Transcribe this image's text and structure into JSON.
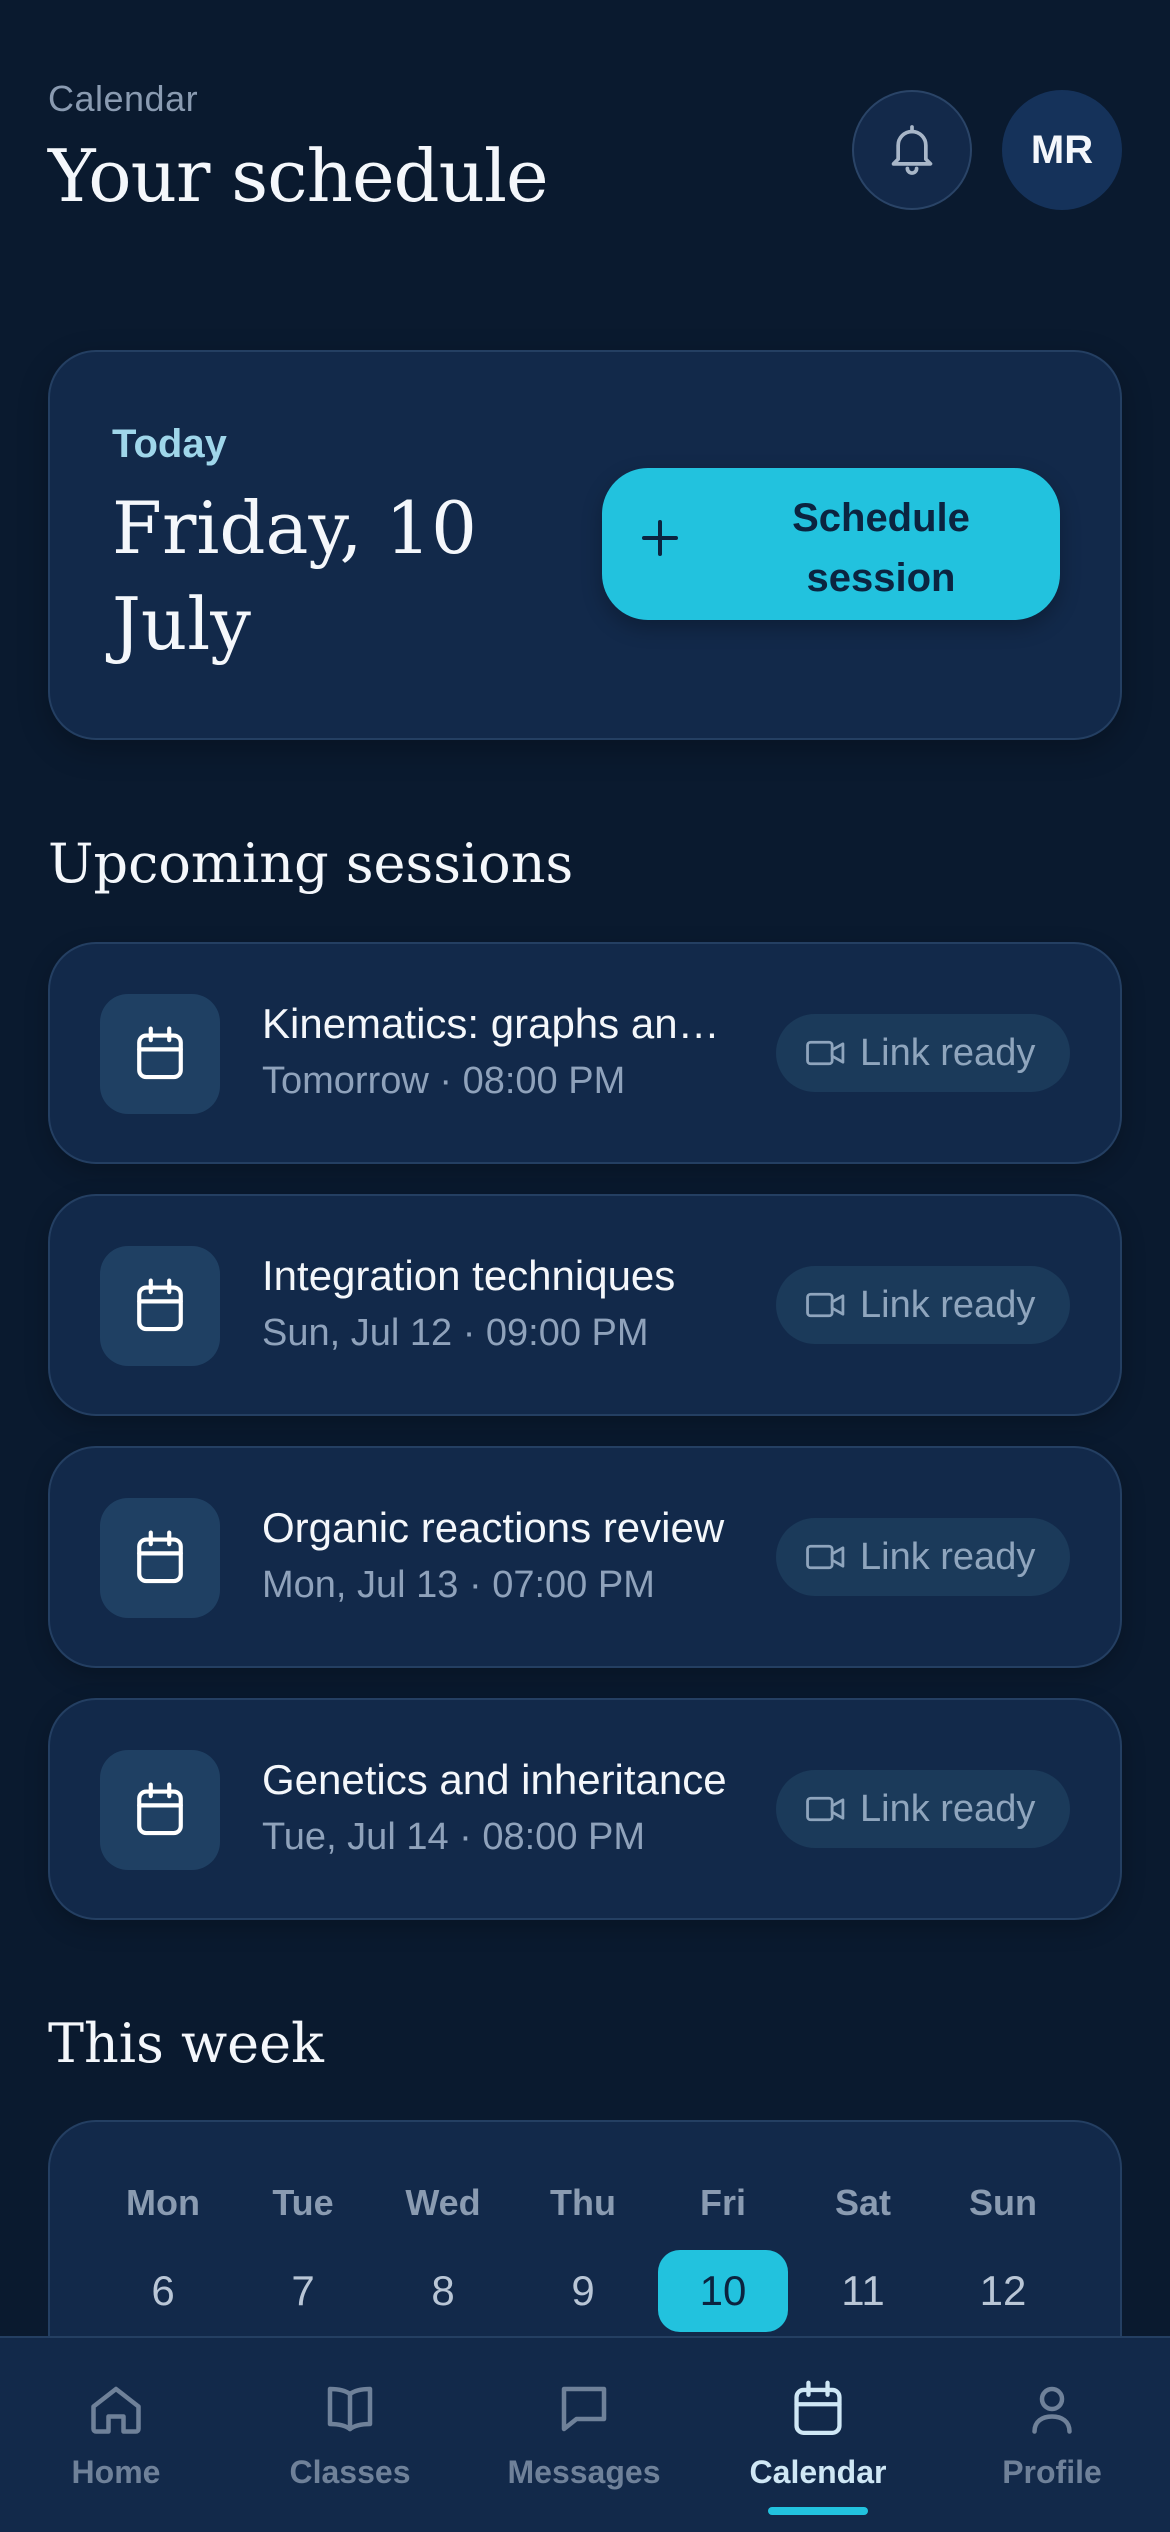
{
  "header": {
    "eyebrow": "Calendar",
    "title": "Your schedule",
    "avatar_initials": "MR"
  },
  "today": {
    "label": "Today",
    "date": "Friday, 10 July",
    "schedule_button": "Schedule session"
  },
  "upcoming": {
    "title": "Upcoming sessions",
    "sessions": [
      {
        "title": "Kinematics: graphs and motion",
        "time": "Tomorrow · 08:00 PM",
        "link": "Link ready"
      },
      {
        "title": "Integration techniques",
        "time": "Sun, Jul 12 · 09:00 PM",
        "link": "Link ready"
      },
      {
        "title": "Organic reactions review",
        "time": "Mon, Jul 13 · 07:00 PM",
        "link": "Link ready"
      },
      {
        "title": "Genetics and inheritance",
        "time": "Tue, Jul 14 · 08:00 PM",
        "link": "Link ready"
      }
    ]
  },
  "week": {
    "title": "This week",
    "days": [
      {
        "name": "Mon",
        "date": "6"
      },
      {
        "name": "Tue",
        "date": "7"
      },
      {
        "name": "Wed",
        "date": "8"
      },
      {
        "name": "Thu",
        "date": "9"
      },
      {
        "name": "Fri",
        "date": "10",
        "selected": true
      },
      {
        "name": "Sat",
        "date": "11"
      },
      {
        "name": "Sun",
        "date": "12"
      }
    ]
  },
  "nav": {
    "items": [
      {
        "label": "Home",
        "icon": "home-icon"
      },
      {
        "label": "Classes",
        "icon": "book-icon"
      },
      {
        "label": "Messages",
        "icon": "message-icon"
      },
      {
        "label": "Calendar",
        "icon": "calendar-icon",
        "active": true
      },
      {
        "label": "Profile",
        "icon": "user-icon"
      }
    ]
  },
  "colors": {
    "background": "#0a1a2f",
    "card": "#12294a",
    "accent": "#22c2de",
    "muted_text": "#8a9bb1"
  }
}
